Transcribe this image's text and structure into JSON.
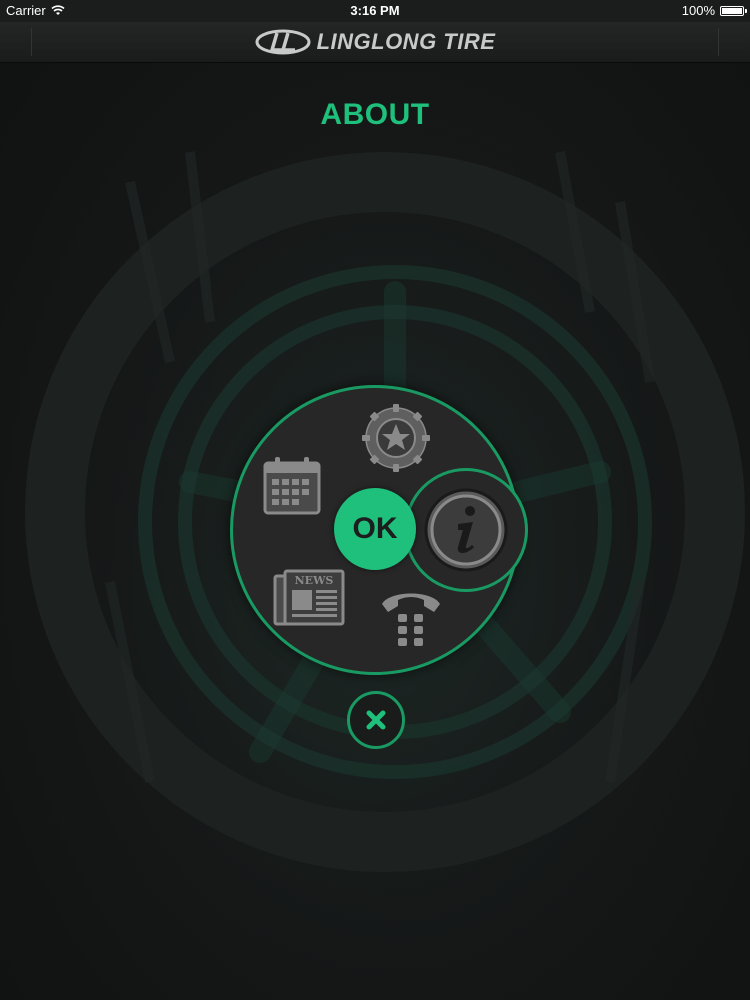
{
  "status_bar": {
    "carrier": "Carrier",
    "time": "3:16 PM",
    "battery": "100%"
  },
  "nav": {
    "brand": "LINGLONG TIRE",
    "logo_icon": "linglong-ll-logo"
  },
  "page": {
    "title": "ABOUT"
  },
  "menu": {
    "ok_label": "OK",
    "items": [
      {
        "id": "tires",
        "icon": "tire-icon"
      },
      {
        "id": "calendar",
        "icon": "calendar-icon"
      },
      {
        "id": "about",
        "icon": "info-icon",
        "selected": true
      },
      {
        "id": "news",
        "icon": "news-icon",
        "icon_text": "NEWS"
      },
      {
        "id": "contact",
        "icon": "phone-icon"
      }
    ],
    "close_icon": "close-icon"
  },
  "colors": {
    "accent": "#1fbf7c",
    "ring": "#1a9a63",
    "disc": "#262726",
    "icon_gray": "#7a7a7a"
  }
}
